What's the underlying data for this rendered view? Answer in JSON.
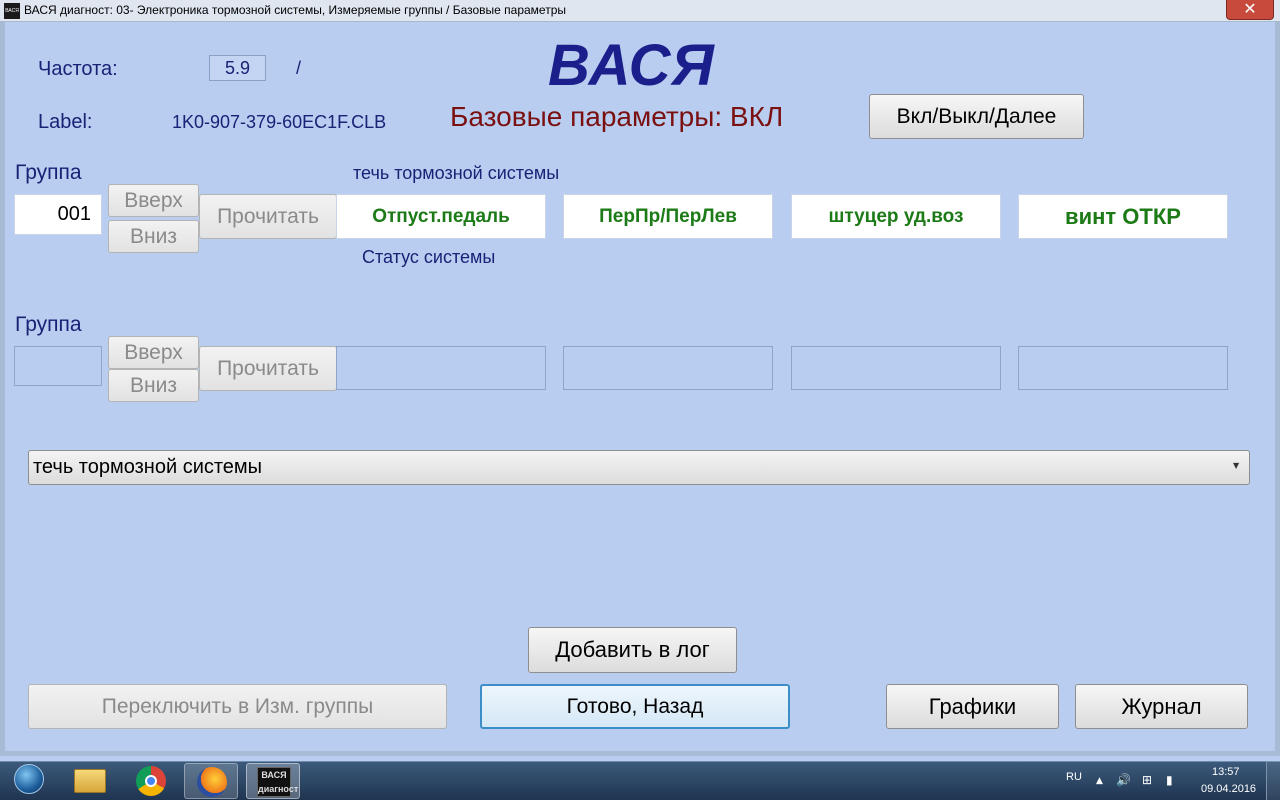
{
  "window": {
    "title": "ВАСЯ диагност: 03- Электроника тормозной системы,  Измеряемые группы / Базовые параметры",
    "app_icon_text": "ВАСЯ",
    "close_glyph": "✕"
  },
  "header": {
    "frequency_label": "Частота:",
    "frequency_value": "5.9",
    "frequency_separator": "/",
    "brand": "ВАСЯ",
    "label_label": "Label:",
    "label_value": "1K0-907-379-60EC1F.CLB",
    "basic_status": "Базовые параметры: ВКЛ",
    "toggle_button": "Вкл/Выкл/Далее"
  },
  "group1": {
    "label": "Группа",
    "number": "001",
    "up_button": "Вверх",
    "down_button": "Вниз",
    "read_button": "Прочитать",
    "name": "течь тормозной системы",
    "status": "Статус системы",
    "values": [
      "Отпуст.педаль",
      "ПерПр/ПерЛев",
      "штуцер уд.воз",
      "винт ОТКР"
    ]
  },
  "group2": {
    "label": "Группа",
    "number": "",
    "up_button": "Вверх",
    "down_button": "Вниз",
    "read_button": "Прочитать",
    "values": [
      "",
      "",
      "",
      ""
    ]
  },
  "procedure_select": {
    "selected": "течь тормозной системы",
    "arrow": "▼"
  },
  "buttons": {
    "add_to_log": "Добавить в лог",
    "switch_to_groups": "Переключить в Изм. группы",
    "done_back": "Готово, Назад",
    "charts": "Графики",
    "journal": "Журнал"
  },
  "taskbar": {
    "vasya_label": "ВАСЯ диагност",
    "language": "RU",
    "time": "13:57",
    "date": "09.04.2016",
    "tray_up_glyph": "▲",
    "sound_glyph": "🔊",
    "network_glyph": "⊞",
    "signal_glyph": "▮"
  },
  "colors": {
    "background": "#b8cdf0",
    "brand": "#1a1f8c",
    "status_red": "#7a1010",
    "value_green": "#1c7a17",
    "label_navy": "#1a2276"
  }
}
